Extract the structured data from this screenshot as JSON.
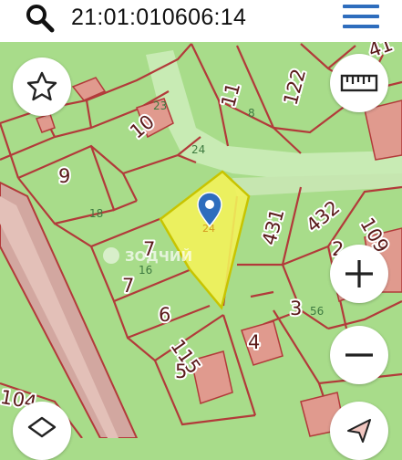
{
  "search": {
    "query": "21:01:010606:14"
  },
  "colors": {
    "map_background": "#a8dc8a",
    "parcel_border": "#b23a3a",
    "selected_fill": "#f2f25a",
    "selected_border": "#c8c400",
    "accent": "#2e6dbd",
    "building_fill": "#e09a8e"
  },
  "parcels": {
    "p9": "9",
    "p10": "10",
    "p11": "11",
    "p122": "122",
    "p7a": "7",
    "p7b": "7",
    "p6": "6",
    "p115": "115",
    "p5": "5",
    "p4": "4",
    "p3": "3",
    "p431": "431",
    "p432": "432",
    "p109": "109",
    "p2": "2",
    "p104": "104",
    "p41": "41"
  },
  "sublabels": {
    "s23": "23",
    "s24": "24",
    "s8": "8",
    "s18": "18",
    "s16": "16",
    "s56": "56"
  },
  "watermark": {
    "text": "ЗОДЧИЙ"
  },
  "buttons": {
    "favorite": "star-icon",
    "ruler": "ruler-icon",
    "zoom_in": "plus-icon",
    "zoom_out": "minus-icon",
    "layers": "layers-icon",
    "locate": "navigation-arrow-icon"
  }
}
